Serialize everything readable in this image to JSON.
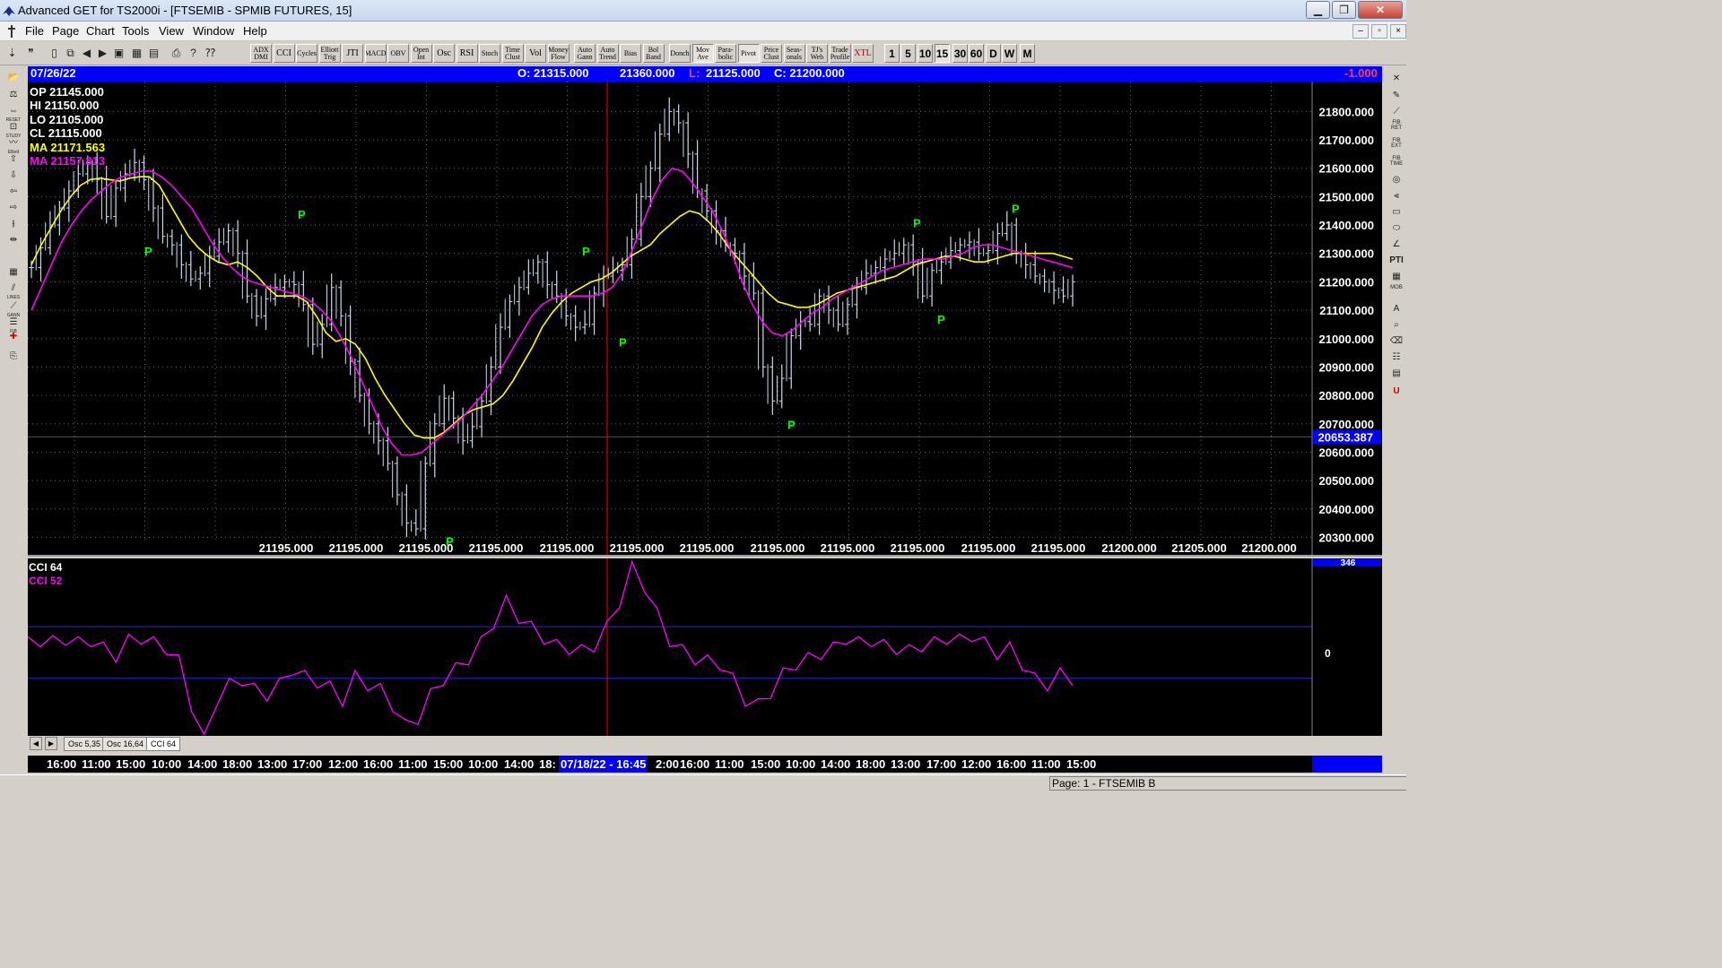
{
  "window": {
    "title": "Advanced GET for TS2000i - [FTSEMIB - SPMIB FUTURES, 15]",
    "minimize": "▁",
    "maximize": "❐",
    "close": "✕"
  },
  "menu": {
    "items": [
      {
        "label": "File",
        "key": "F"
      },
      {
        "label": "Page",
        "key": "P"
      },
      {
        "label": "Chart",
        "key": "C"
      },
      {
        "label": "Tools",
        "key": "T"
      },
      {
        "label": "View",
        "key": "V"
      },
      {
        "label": "Window",
        "key": "W"
      },
      {
        "label": "Help",
        "key": "H"
      }
    ]
  },
  "toolbar": {
    "studies": [
      "ADX DMI",
      "CCI",
      "Cycles",
      "Elliott Trig",
      "JTI",
      "MACD",
      "OBV",
      "Open Int",
      "Osc",
      "RSI",
      "Stoch",
      "Time Clust",
      "Vol",
      "Money Flow",
      "Auto Gann",
      "Auto Trend",
      "Bias",
      "Bol Band",
      "Donch",
      "Mov Ave",
      "Para- bolic",
      "Pivot",
      "Price Clust",
      "Seas- onals",
      "TJ's Web",
      "Trade Profile",
      "XTL"
    ],
    "timeframes": [
      "1",
      "5",
      "10",
      "15",
      "30",
      "60",
      "D",
      "W",
      "M"
    ],
    "active_timeframe": "15"
  },
  "infobar": {
    "date": "07/26/22",
    "open": "O: 21315.000",
    "high": "21360.000",
    "low_prefix": "L:",
    "low": "21125.000",
    "close": "C: 21200.000",
    "change": "-1.000"
  },
  "overlay": {
    "op": "OP  21145.000",
    "hi": "HI   21150.000",
    "lo": "LO  21105.000",
    "cl": "CL  21115.000",
    "ma1": "MA  21171.563",
    "ma2": "MA  21157.813"
  },
  "price_axis": {
    "ticks": [
      "21800.000",
      "21700.000",
      "21600.000",
      "21500.000",
      "21400.000",
      "21300.000",
      "21200.000",
      "21100.000",
      "21000.000",
      "20900.000",
      "20800.000",
      "20700.000",
      "20600.000",
      "20500.000",
      "20400.000",
      "20300.000"
    ],
    "cursor_price": "20653.387"
  },
  "bottom_price_labels": [
    "21195.000",
    "21195.000",
    "21195.000",
    "21195.000",
    "21195.000",
    "21195.000",
    "21195.000",
    "21195.000",
    "21195.000",
    "21195.000",
    "21195.000",
    "21195.000",
    "21200.000",
    "21205.000",
    "21200.000"
  ],
  "pivot_label": "P",
  "oscillator": {
    "label1": "CCI 64",
    "label2": "CCI  52",
    "axis_zero": "0",
    "axis_top": "346"
  },
  "tabs": [
    "Osc 5,35",
    "Osc 16,64",
    "CCI 64"
  ],
  "time_axis": {
    "labels": [
      "16:00",
      "11:00",
      "15:00",
      "10:00",
      "14:00",
      "18:00",
      "13:00",
      "17:00",
      "12:00",
      "16:00",
      "11:00",
      "15:00",
      "10:00",
      "14:00",
      "18:",
      "2:00",
      "16:00",
      "11:00",
      "15:00",
      "10:00",
      "14:00",
      "18:00",
      "13:00",
      "17:00",
      "12:00",
      "16:00",
      "11:00",
      "15:00"
    ],
    "cursor_date": "07/18/22 - 16:45"
  },
  "status": {
    "page": "Page: 1 - FTSEMIB B"
  },
  "colors": {
    "price_bars": "#c8dcf0",
    "ma_fast": "#ffff00",
    "ma_slow": "#ff00ff",
    "pivot": "#00ff00",
    "cursor": "#ff0000",
    "infobar": "#0000ff"
  },
  "chart_data": {
    "type": "line",
    "title": "FTSEMIB - SPMIB FUTURES, 15",
    "price_range": [
      20270,
      21880
    ],
    "close_series": [
      21250,
      21320,
      21400,
      21460,
      21520,
      21580,
      21620,
      21560,
      21430,
      21530,
      21580,
      21620,
      21560,
      21460,
      21360,
      21330,
      21260,
      21210,
      21230,
      21290,
      21340,
      21380,
      21300,
      21150,
      21080,
      21140,
      21180,
      21200,
      21190,
      21120,
      20980,
      21050,
      21180,
      21080,
      20920,
      20800,
      20700,
      20640,
      20560,
      20450,
      20350,
      20330,
      20560,
      20700,
      20790,
      20720,
      20640,
      20690,
      20780,
      20900,
      21040,
      21130,
      21180,
      21230,
      21270,
      21190,
      21150,
      21080,
      21040,
      21050,
      21160,
      21220,
      21240,
      21260,
      21350,
      21500,
      21600,
      21720,
      21800,
      21760,
      21650,
      21520,
      21450,
      21380,
      21330,
      21300,
      21220,
      21160,
      20900,
      20780,
      20860,
      21010,
      21060,
      21050,
      21150,
      21100,
      21050,
      21120,
      21180,
      21230,
      21250,
      21280,
      21300,
      21330,
      21270,
      21150,
      21240,
      21270,
      21310,
      21330,
      21340,
      21300,
      21310,
      21370,
      21400,
      21300,
      21260,
      21220,
      21200,
      21170,
      21150,
      21200
    ],
    "ma_fast_series": [
      21260,
      21330,
      21390,
      21450,
      21500,
      21540,
      21560,
      21565,
      21560,
      21555,
      21565,
      21570,
      21570,
      21540,
      21480,
      21420,
      21360,
      21320,
      21290,
      21270,
      21260,
      21270,
      21250,
      21220,
      21180,
      21150,
      21150,
      21150,
      21130,
      21080,
      21020,
      20990,
      21000,
      20980,
      20930,
      20860,
      20800,
      20750,
      20700,
      20660,
      20650,
      20650,
      20670,
      20700,
      20730,
      20750,
      20760,
      20770,
      20800,
      20850,
      20910,
      20970,
      21040,
      21090,
      21130,
      21160,
      21180,
      21200,
      21210,
      21230,
      21260,
      21290,
      21310,
      21330,
      21370,
      21400,
      21430,
      21450,
      21440,
      21410,
      21370,
      21320,
      21280,
      21240,
      21200,
      21160,
      21130,
      21120,
      21110,
      21110,
      21120,
      21140,
      21160,
      21170,
      21180,
      21190,
      21200,
      21210,
      21220,
      21240,
      21260,
      21270,
      21280,
      21290,
      21290,
      21280,
      21270,
      21270,
      21280,
      21290,
      21300,
      21300,
      21300,
      21300,
      21300,
      21290,
      21280
    ],
    "ma_slow_series": [
      21100,
      21180,
      21260,
      21340,
      21400,
      21450,
      21490,
      21520,
      21550,
      21570,
      21580,
      21590,
      21590,
      21570,
      21540,
      21500,
      21460,
      21400,
      21340,
      21290,
      21250,
      21220,
      21200,
      21190,
      21180,
      21170,
      21160,
      21150,
      21130,
      21100,
      21060,
      21000,
      20930,
      20850,
      20770,
      20690,
      20630,
      20590,
      20590,
      20600,
      20630,
      20660,
      20690,
      20720,
      20760,
      20800,
      20850,
      20900,
      20960,
      21020,
      21080,
      21120,
      21140,
      21150,
      21150,
      21150,
      21150,
      21160,
      21180,
      21230,
      21310,
      21400,
      21490,
      21560,
      21600,
      21590,
      21550,
      21500,
      21450,
      21380,
      21300,
      21200,
      21120,
      21060,
      21020,
      21010,
      21030,
      21060,
      21090,
      21110,
      21140,
      21160,
      21180,
      21200,
      21220,
      21240,
      21250,
      21260,
      21270,
      21280,
      21280,
      21280,
      21290,
      21300,
      21320,
      21330,
      21330,
      21320,
      21310,
      21300,
      21290,
      21280,
      21270,
      21260,
      21250
    ],
    "pivots": [
      {
        "type": "low",
        "index": 6,
        "price": 21330
      },
      {
        "type": "high",
        "index": 14,
        "price": 21410
      },
      {
        "type": "low",
        "index": 21,
        "price": 20310
      },
      {
        "type": "high",
        "index": 30,
        "price": 21280
      },
      {
        "type": "low",
        "index": 34,
        "price": 21010
      },
      {
        "type": "low",
        "index": 41,
        "price": 20720
      },
      {
        "type": "high",
        "index": 51,
        "price": 21380
      },
      {
        "type": "low",
        "index": 53,
        "price": 21090
      },
      {
        "type": "high",
        "index": 58,
        "price": 21430
      }
    ],
    "cci_series": [
      40,
      50,
      45,
      55,
      40,
      50,
      20,
      -10,
      50,
      60,
      40,
      20,
      -30,
      -200,
      -340,
      -180,
      -120,
      -100,
      -140,
      -160,
      -120,
      -60,
      -90,
      -110,
      -130,
      -180,
      -90,
      -120,
      -140,
      -200,
      -280,
      -250,
      -160,
      -100,
      -60,
      -20,
      40,
      120,
      200,
      140,
      100,
      60,
      30,
      20,
      10,
      30,
      100,
      200,
      330,
      260,
      150,
      50,
      10,
      -20,
      -30,
      -40,
      -100,
      -180,
      -200,
      -150,
      -80,
      -40,
      -20,
      0,
      20,
      60,
      40,
      50,
      30,
      20,
      10,
      30,
      40,
      60,
      50,
      70,
      40,
      0,
      20,
      -40,
      -100,
      -120,
      -80,
      -100
    ],
    "cci_levels": [
      100,
      0,
      -100
    ]
  }
}
